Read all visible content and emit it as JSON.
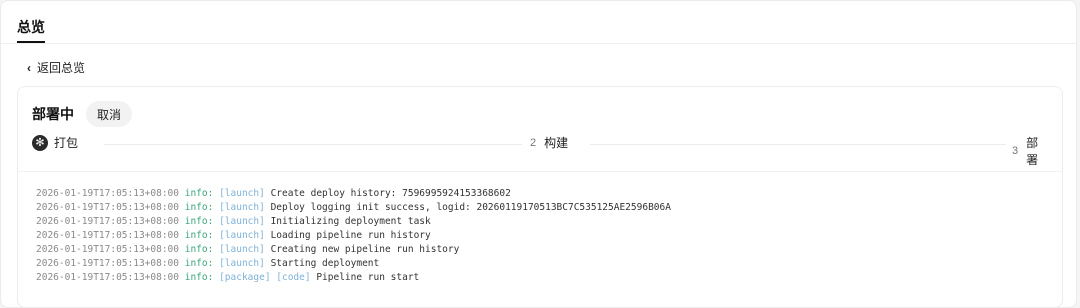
{
  "header": {
    "tab_label": "总览"
  },
  "back": {
    "label": "返回总览"
  },
  "deployment": {
    "status": "部署中",
    "cancel_label": "取消",
    "steps": [
      {
        "number": "",
        "label": "打包",
        "state": "done"
      },
      {
        "number": "2",
        "label": "构建",
        "state": "pending"
      },
      {
        "number": "3",
        "label": "部署",
        "state": "pending"
      }
    ]
  },
  "logs": [
    {
      "timestamp": "2026-01-19T17:05:13+08:00",
      "level": "info:",
      "tags": "[launch]",
      "message": "Create deploy history: 7596995924153368602"
    },
    {
      "timestamp": "2026-01-19T17:05:13+08:00",
      "level": "info:",
      "tags": "[launch]",
      "message": "Deploy logging init success, logid: 20260119170513BC7C535125AE2596B06A"
    },
    {
      "timestamp": "2026-01-19T17:05:13+08:00",
      "level": "info:",
      "tags": "[launch]",
      "message": "Initializing deployment task"
    },
    {
      "timestamp": "2026-01-19T17:05:13+08:00",
      "level": "info:",
      "tags": "[launch]",
      "message": "Loading pipeline run history"
    },
    {
      "timestamp": "2026-01-19T17:05:13+08:00",
      "level": "info:",
      "tags": "[launch]",
      "message": "Creating new pipeline run history"
    },
    {
      "timestamp": "2026-01-19T17:05:13+08:00",
      "level": "info:",
      "tags": "[launch]",
      "message": "Starting deployment"
    },
    {
      "timestamp": "2026-01-19T17:05:13+08:00",
      "level": "info:",
      "tags": "[package] [code]",
      "message": "Pipeline run start"
    }
  ]
}
